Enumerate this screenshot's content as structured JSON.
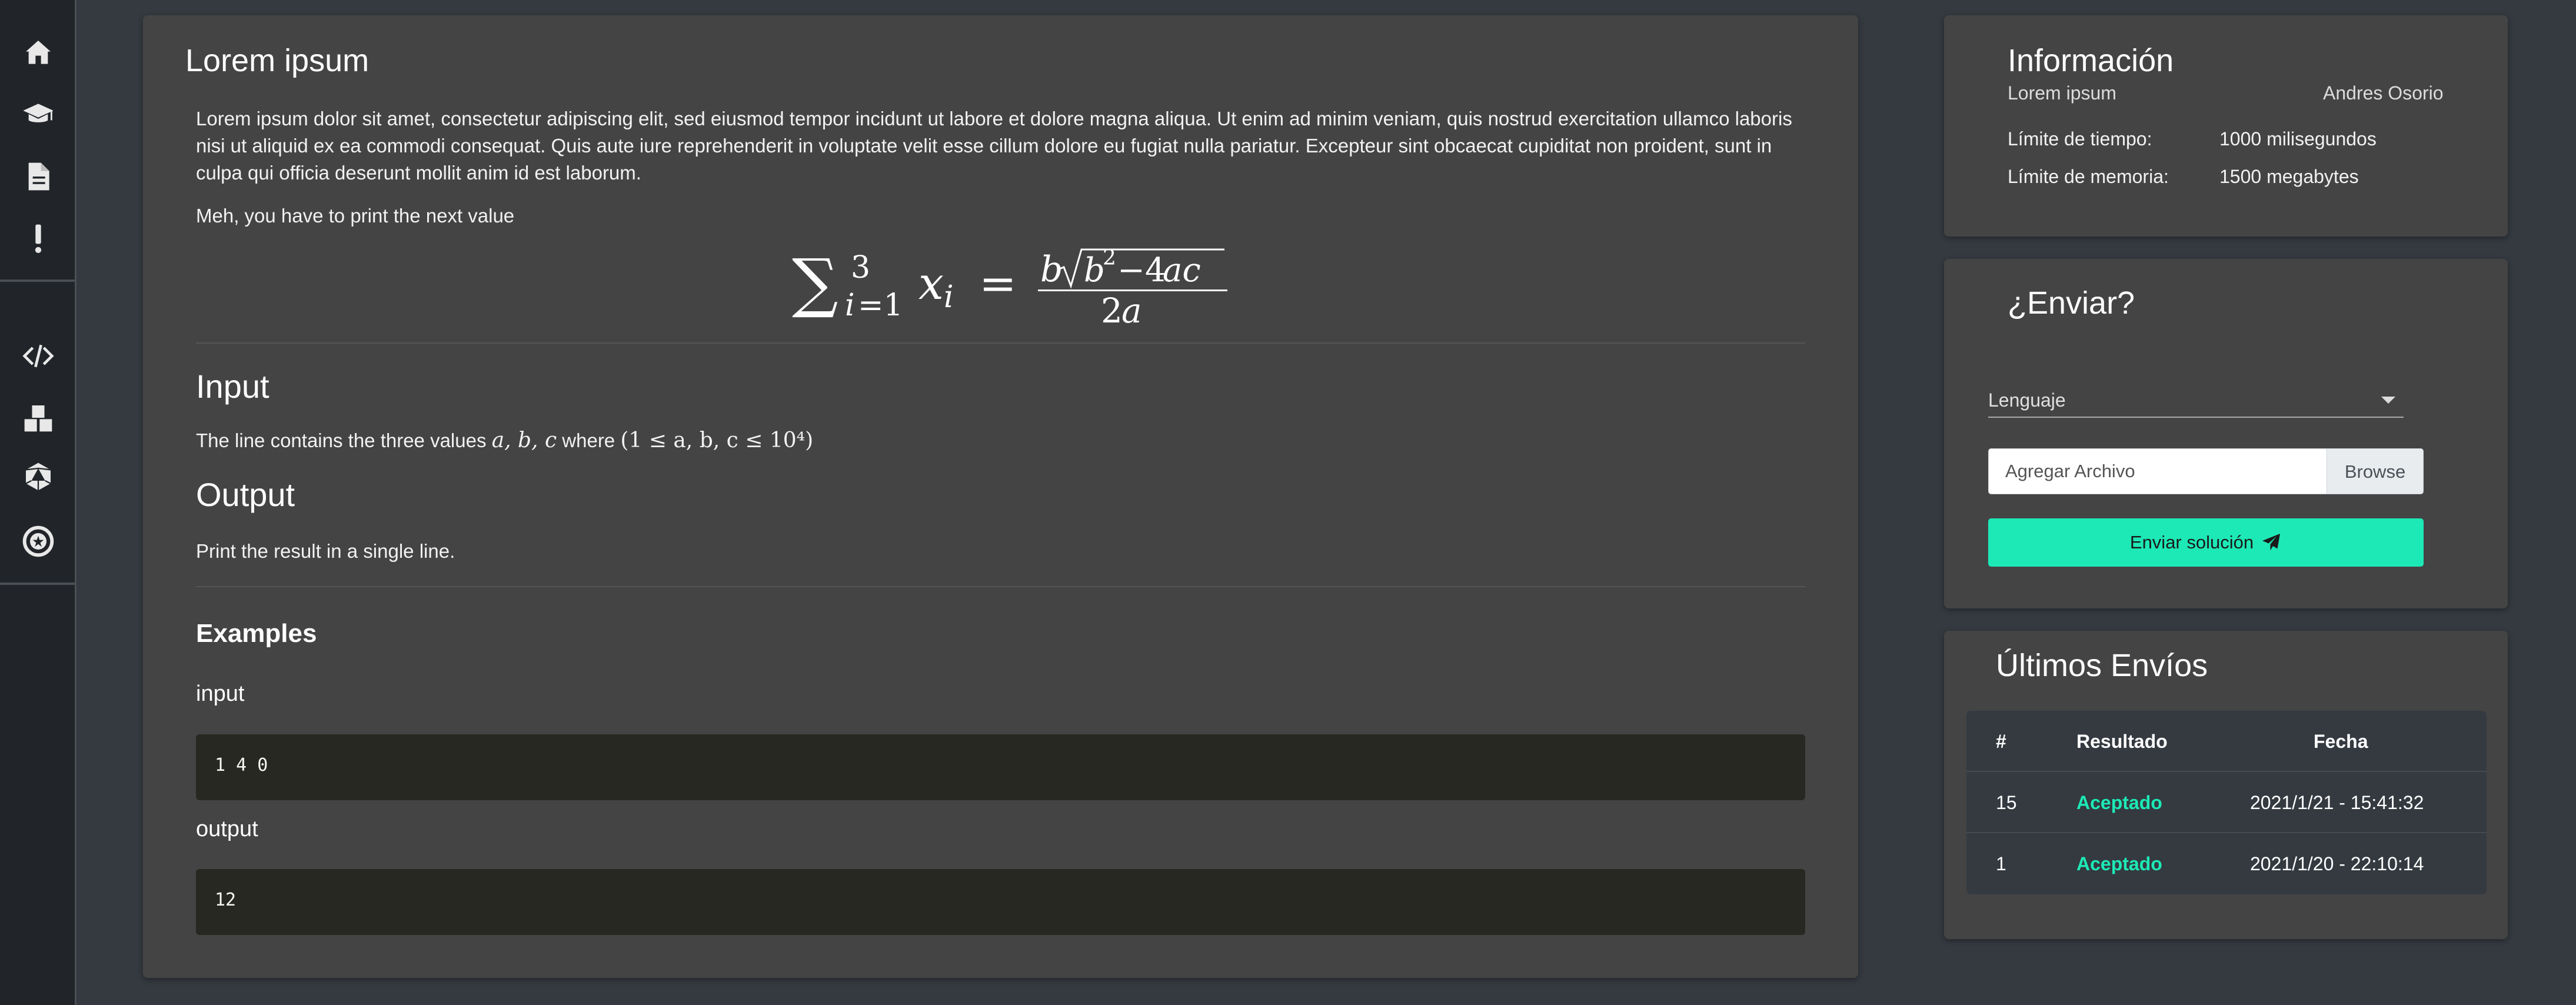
{
  "sidebar": {
    "items": [
      {
        "icon": "home-icon"
      },
      {
        "icon": "graduation-cap-icon"
      },
      {
        "icon": "document-icon"
      },
      {
        "icon": "exclamation-icon"
      },
      {
        "icon": "code-icon"
      },
      {
        "icon": "boxes-icon"
      },
      {
        "icon": "dice-icon"
      },
      {
        "icon": "star-badge-icon"
      }
    ]
  },
  "problem": {
    "title": "Lorem ipsum",
    "description": "Lorem ipsum dolor sit amet, consectetur adipiscing elit, sed eiusmod tempor incidunt ut labore et dolore magna aliqua. Ut enim ad minim veniam, quis nostrud exercitation ullamco laboris nisi ut aliquid ex ea commodi consequat. Quis aute iure reprehenderit in voluptate velit esse cillum dolore eu fugiat nulla pariatur. Excepteur sint obcaecat cupiditat non proident, sunt in culpa qui officia deserunt mollit anim id est laborum.",
    "instruction": "Meh, you have to print the next value",
    "input_heading": "Input",
    "input_text_prefix": "The line contains the three values",
    "input_vars": "a, b, c",
    "input_where": "where",
    "input_constraint": "(1 ≤ a, b, c ≤ 10⁴)",
    "output_heading": "Output",
    "output_text": "Print the result in a single line.",
    "examples_heading": "Examples",
    "example_input_label": "input",
    "example_input_value": "1 4 0",
    "example_output_label": "output",
    "example_output_value": "12"
  },
  "info_card": {
    "title": "Información",
    "problem_name": "Lorem ipsum",
    "author": "Andres Osorio",
    "time_limit_label": "Límite de tiempo:",
    "time_limit_value": "1000 milisegundos",
    "memory_limit_label": "Límite de memoria:",
    "memory_limit_value": "1500 megabytes"
  },
  "submit_card": {
    "title": "¿Enviar?",
    "language_placeholder": "Lenguaje",
    "file_placeholder": "Agregar Archivo",
    "browse_label": "Browse",
    "submit_label": "Enviar solución"
  },
  "submissions_card": {
    "title": "Últimos Envíos",
    "headers": [
      "#",
      "Resultado",
      "Fecha"
    ],
    "rows": [
      {
        "id": "15",
        "result": "Aceptado",
        "date": "2021/1/21 - 15:41:32"
      },
      {
        "id": "1",
        "result": "Aceptado",
        "date": "2021/1/20 - 22:10:14"
      }
    ]
  },
  "colors": {
    "accent": "#1de9b6",
    "panel": "#444444",
    "background": "#343a40",
    "sidebar": "#212529",
    "code_bg": "#272822"
  }
}
